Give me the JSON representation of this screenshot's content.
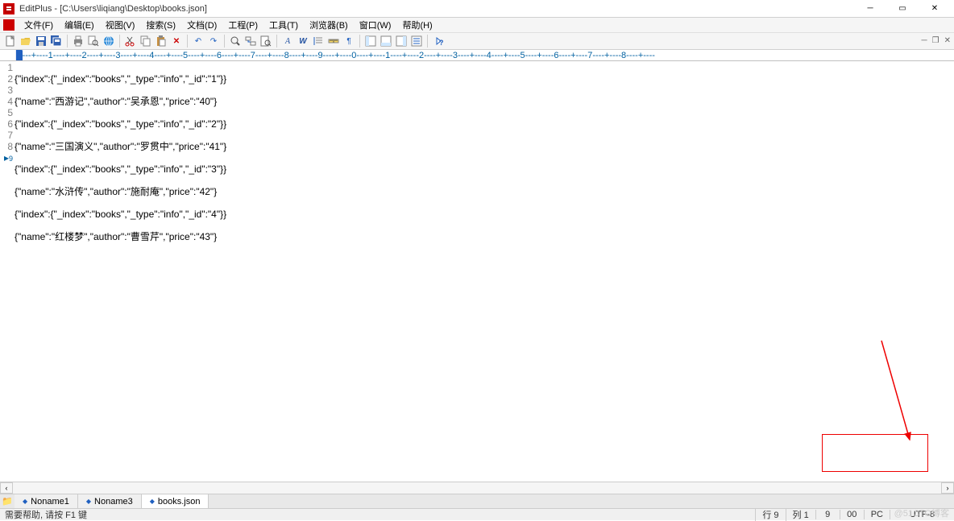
{
  "title": "EditPlus - [C:\\Users\\liqiang\\Desktop\\books.json]",
  "menus": [
    "文件(F)",
    "编辑(E)",
    "视图(V)",
    "搜索(S)",
    "文档(D)",
    "工程(P)",
    "工具(T)",
    "浏览器(B)",
    "窗口(W)",
    "帮助(H)"
  ],
  "ruler": "---+----1----+----2----+----3----+----4----+----5----+----6----+----7----+----8----+----9----+----0----+----1----+----2----+----3----+----4----+----5----+----6----+----7----+----8----+----",
  "lines": [
    "{\"index\":{\"_index\":\"books\",\"_type\":\"info\",\"_id\":\"1\"}}",
    "{\"name\":\"西游记\",\"author\":\"吴承恩\",\"price\":\"40\"}",
    "{\"index\":{\"_index\":\"books\",\"_type\":\"info\",\"_id\":\"2\"}}",
    "{\"name\":\"三国演义\",\"author\":\"罗贯中\",\"price\":\"41\"}",
    "{\"index\":{\"_index\":\"books\",\"_type\":\"info\",\"_id\":\"3\"}}",
    "{\"name\":\"水浒传\",\"author\":\"施耐庵\",\"price\":\"42\"}",
    "{\"index\":{\"_index\":\"books\",\"_type\":\"info\",\"_id\":\"4\"}}",
    "{\"name\":\"红楼梦\",\"author\":\"曹雪芹\",\"price\":\"43\"}"
  ],
  "tabs": [
    {
      "label": "Noname1",
      "active": false
    },
    {
      "label": "Noname3",
      "active": false
    },
    {
      "label": "books.json",
      "active": true
    }
  ],
  "status": {
    "hint": "需要帮助, 请按 F1 键",
    "line_label": "行",
    "line": "9",
    "col_label": "列",
    "col": "1",
    "total": "9",
    "code": "00",
    "platform": "PC",
    "encoding": "UTF-8"
  },
  "watermark": "@51CTO博客"
}
